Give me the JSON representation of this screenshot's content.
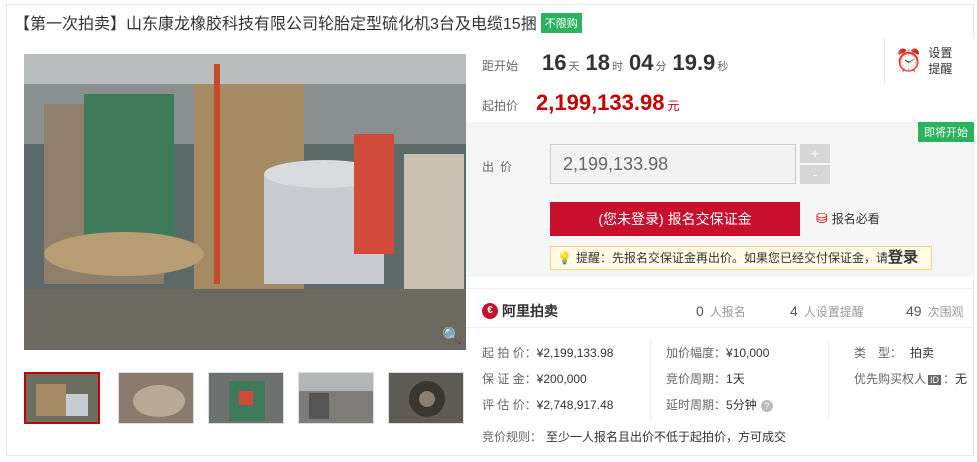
{
  "title": {
    "text": "【第一次拍卖】山东康龙橡胶科技有限公司轮胎定型硫化机3台及电缆15捆",
    "tag": "不限购"
  },
  "countdown": {
    "label": "距开始",
    "days": "16",
    "days_unit": "天",
    "hours": "18",
    "hours_unit": "时",
    "minutes": "04",
    "minutes_unit": "分",
    "seconds": "19.9",
    "seconds_unit": "秒"
  },
  "start_price": {
    "label": "起拍价",
    "value": "2,199,133.98",
    "unit": "元"
  },
  "remind": {
    "label": "设置提醒"
  },
  "badge": "即将开始",
  "bid": {
    "label": "出价",
    "value": "2,199,133.98",
    "plus": "+",
    "minus": "-",
    "register_button": "(您未登录) 报名交保证金",
    "must_see": "报名必看",
    "tip_text": "提醒：先报名交保证金再出价。如果您已经交付保证金，请",
    "tip_login": "登录"
  },
  "platform": "阿里拍卖",
  "stats": [
    {
      "num": "0",
      "label": "人报名"
    },
    {
      "num": "4",
      "label": "人设置提醒"
    },
    {
      "num": "49",
      "label": "次围观"
    }
  ],
  "details": {
    "start_price_label": "起 拍 价：",
    "start_price": "¥2,199,133.98",
    "deposit_label": "保 证 金：",
    "deposit": "¥200,000",
    "appraisal_label": "评 估 价：",
    "appraisal": "¥2,748,917.48",
    "increment_label": "加价幅度：",
    "increment": "¥10,000",
    "cycle_label": "竞价周期：",
    "cycle": "1天",
    "extension_label": "延时周期：",
    "extension": "5分钟",
    "type_label": "类　型：",
    "type": "拍卖",
    "priority_label": "优先购买权人",
    "priority_value": "无",
    "rule_label": "竞价规则：",
    "rule": "至少一人报名且出价不低于起拍价，方可成交"
  },
  "icons": {
    "zoom": "magnifier-icon",
    "clock": "alarm-clock-icon",
    "coin": "coin-stack-icon",
    "bulb": "lightbulb-icon",
    "help": "question-icon",
    "id": "id-card-icon"
  },
  "colors": {
    "accent_red": "#c8102e",
    "price_red": "#c40000",
    "green": "#2ab25d"
  }
}
